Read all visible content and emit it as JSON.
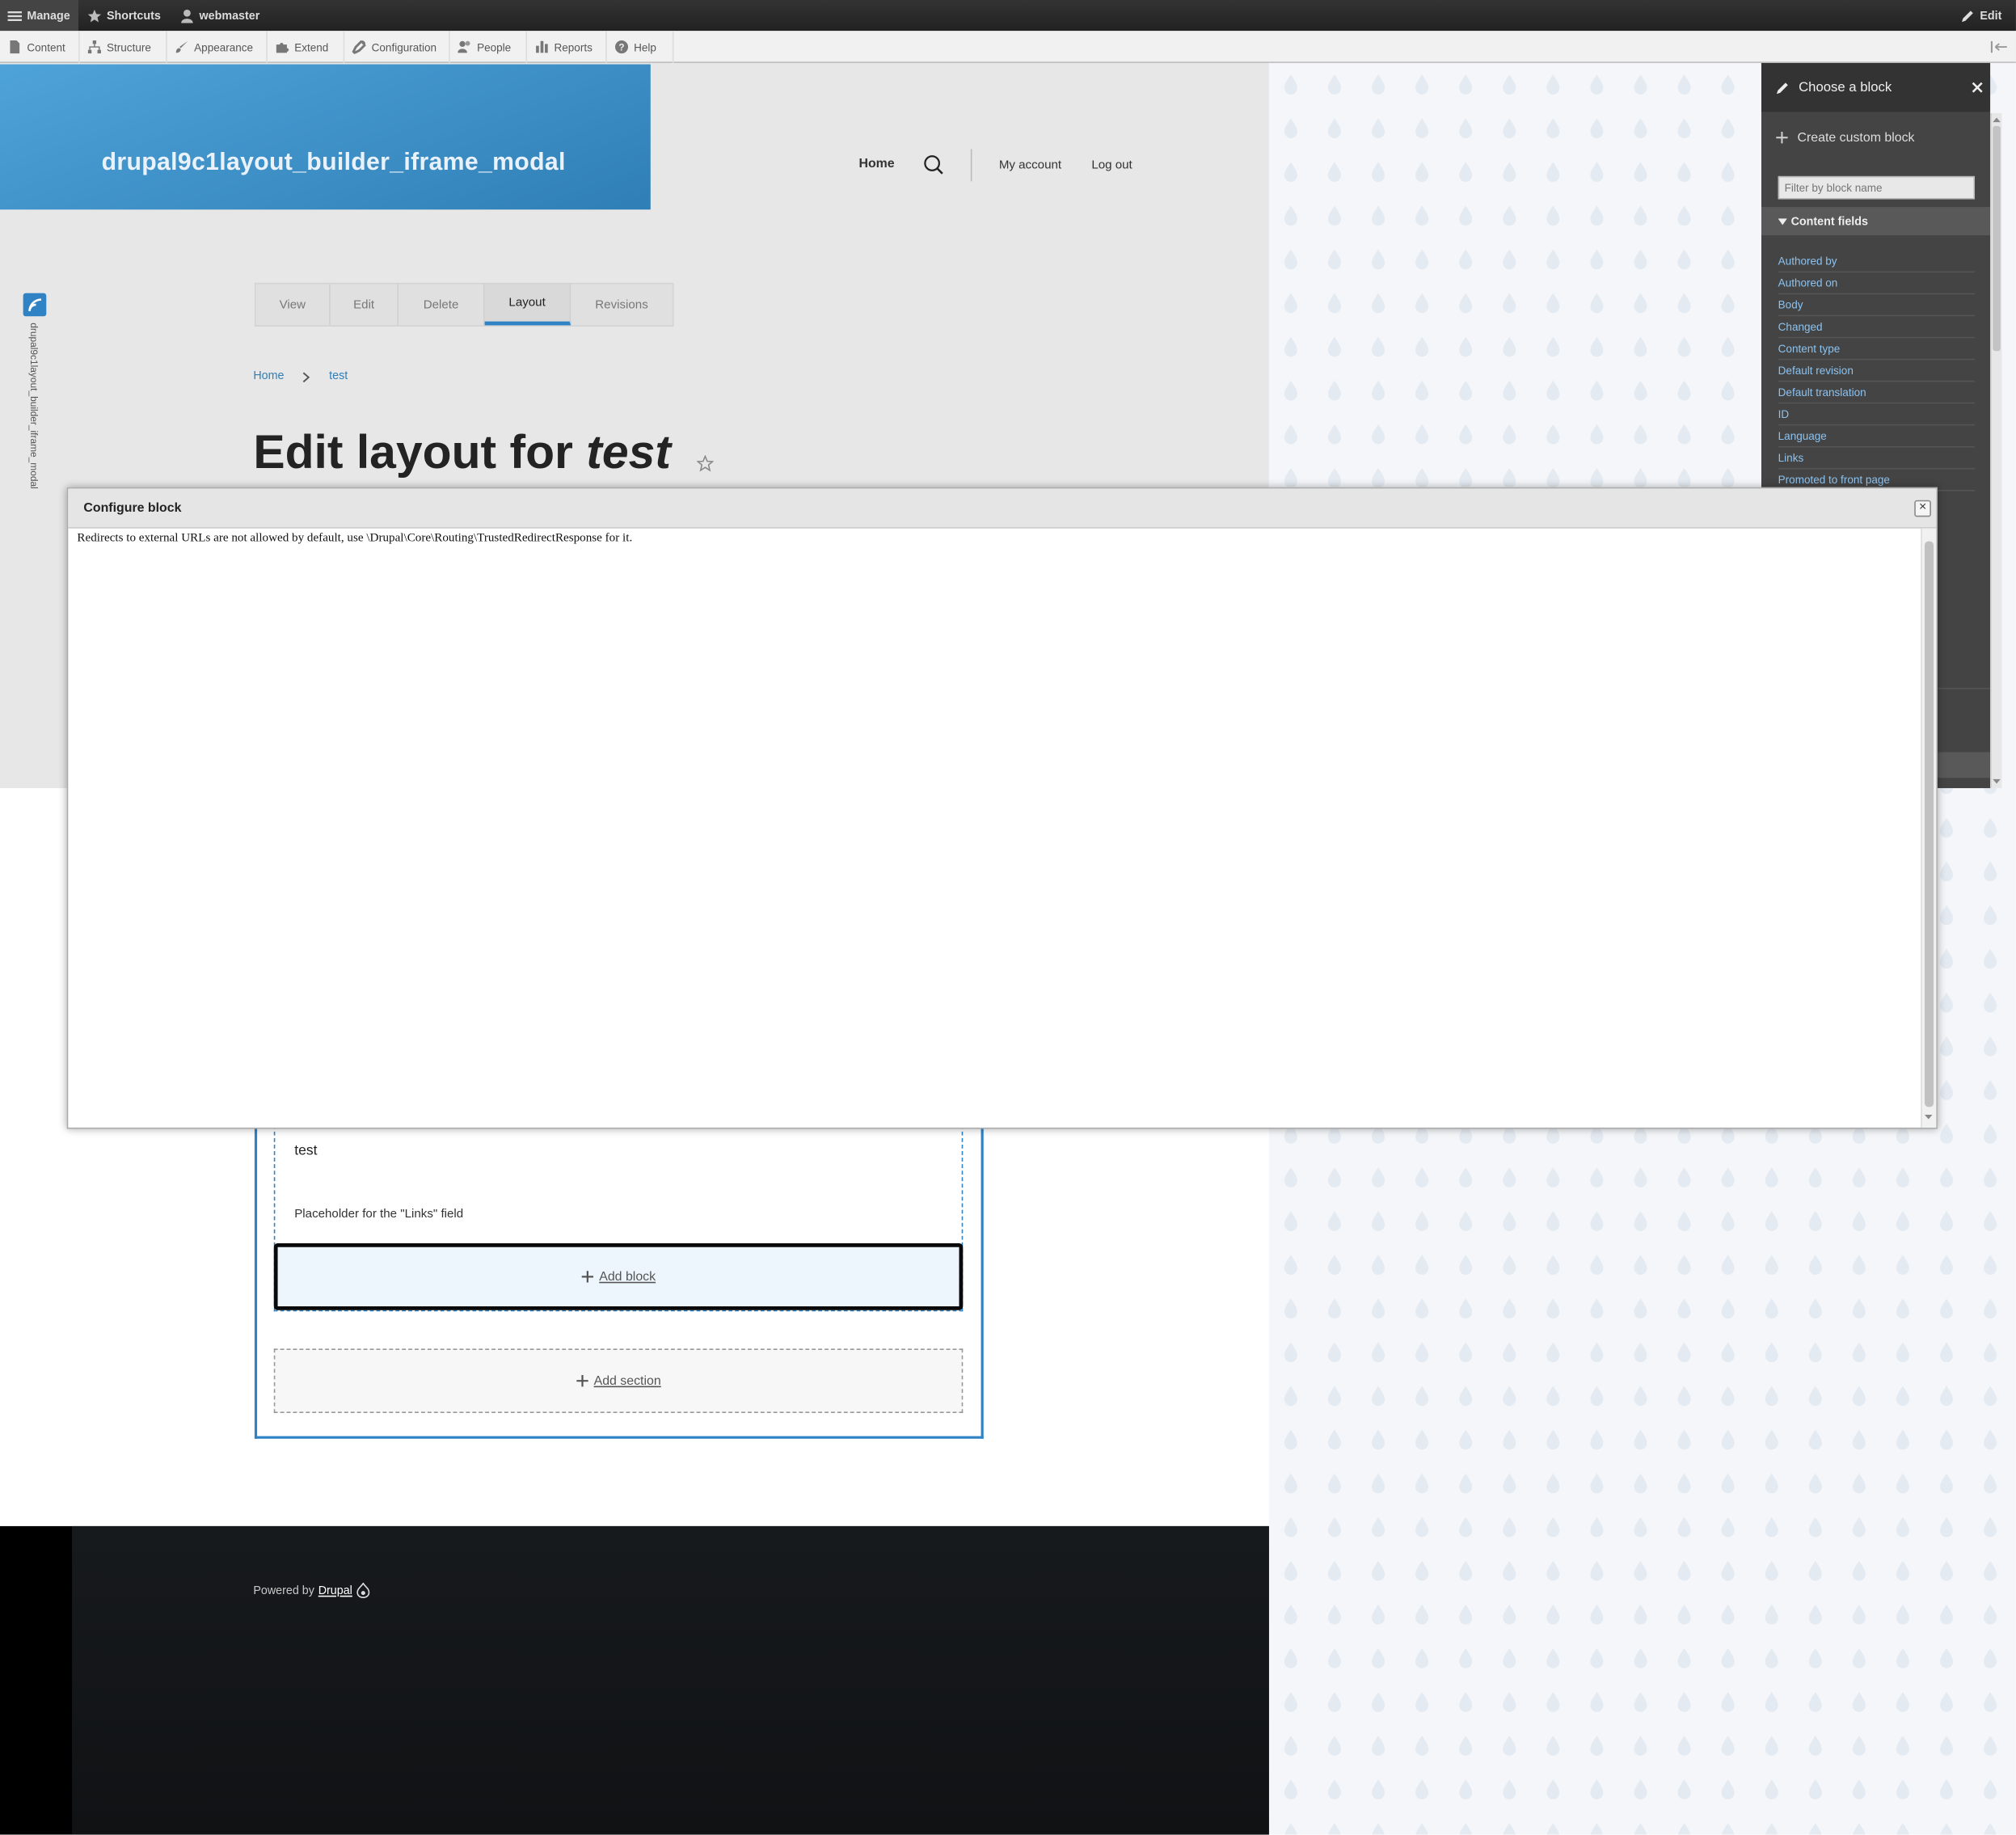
{
  "toolbar": {
    "manage": "Manage",
    "shortcuts": "Shortcuts",
    "user": "webmaster",
    "edit": "Edit"
  },
  "tray": {
    "items": [
      "Content",
      "Structure",
      "Appearance",
      "Extend",
      "Configuration",
      "People",
      "Reports",
      "Help"
    ]
  },
  "site": {
    "name": "drupal9c1layout_builder_iframe_modal",
    "side_label": "drupal9c1layout_builder_iframe_modal"
  },
  "nav": {
    "home": "Home",
    "my_account": "My account",
    "log_out": "Log out"
  },
  "tabs": [
    "View",
    "Edit",
    "Delete",
    "Layout",
    "Revisions"
  ],
  "breadcrumb": {
    "home": "Home",
    "current": "test"
  },
  "page": {
    "title_prefix": "Edit layout for",
    "title_node": "test"
  },
  "section": {
    "title_text": "test",
    "links_placeholder": "Placeholder for the \"Links\" field",
    "add_block": "Add block",
    "add_section": "Add section"
  },
  "footer": {
    "powered_by": "Powered by",
    "drupal": "Drupal"
  },
  "offcanvas": {
    "title": "Choose a block",
    "create": "Create custom block",
    "filter_placeholder": "Filter by block name",
    "group": "Content fields",
    "fields": [
      "Authored by",
      "Authored on",
      "Body",
      "Changed",
      "Content type",
      "Default revision",
      "Default translation",
      "ID",
      "Language",
      "Links",
      "Promoted to front page"
    ]
  },
  "modal": {
    "title": "Configure block",
    "close": "×",
    "message": "Redirects to external URLs are not allowed by default, use \\Drupal\\Core\\Routing\\TrustedRedirectResponse for it."
  },
  "colors": {
    "brand_blue": "#2f83c5",
    "toolbar_dark": "#222222",
    "offcanvas_bg": "#444444"
  }
}
